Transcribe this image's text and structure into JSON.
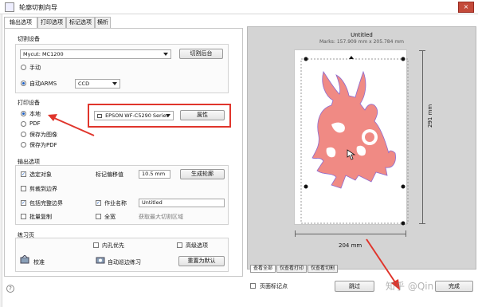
{
  "window": {
    "title": "轮廓切割向导",
    "close_glyph": "×"
  },
  "tabs": [
    {
      "label": "输出选项",
      "active": true
    },
    {
      "label": "打印选项",
      "active": false
    },
    {
      "label": "标记选项",
      "active": false
    },
    {
      "label": "横析",
      "active": false
    }
  ],
  "cut_device": {
    "section_label": "切割设备",
    "device_select_value": "Mycut: MC1200",
    "cut_backend_button": "切割后台",
    "manual_label": "手动",
    "auto_arms_label": "自动ARMS",
    "camera_select_value": "CCD",
    "manual_selected": false,
    "auto_selected": true
  },
  "print_device": {
    "section_label": "打印设备",
    "options": [
      {
        "label": "本地",
        "selected": true
      },
      {
        "label": "PDF",
        "selected": false
      },
      {
        "label": "保存为图像",
        "selected": false
      },
      {
        "label": "保存为PDF",
        "selected": false
      }
    ],
    "printer_select_value": "EPSON WF-C5290 Series",
    "properties_button": "属性"
  },
  "output_options": {
    "section_label": "输出选项",
    "select_object_label": "选定对象",
    "select_object_checked": true,
    "clip_to_border_label": "剪裁到边界",
    "clip_to_border_checked": false,
    "include_full_border_label": "包括完整边界",
    "include_full_border_checked": true,
    "batch_copy_label": "批量复制",
    "batch_copy_checked": false,
    "mark_offset_label": "标记偏移值",
    "mark_offset_value": "10.5 mm",
    "generate_contour_button": "生成轮廓",
    "job_name_label": "作业名称",
    "job_name_checked": true,
    "job_name_value": "Untitled",
    "full_width_label": "全宽",
    "full_width_checked": false,
    "full_width_hint": "获取最大切割区域"
  },
  "practice": {
    "section_label": "练习页",
    "inner_hole_label": "内孔优先",
    "inner_hole_checked": false,
    "advanced_label": "高级选项",
    "advanced_checked": false,
    "calibrate_label": "校准",
    "auto_patrol_label": "自动巡边练习",
    "reset_default_button": "重置为默认"
  },
  "preview": {
    "title": "Untitled",
    "marks": "Marks: 157.909 mm x 205.784 mm",
    "width_dim": "204 mm",
    "height_dim": "291 mm",
    "bottom_tabs": [
      "查看全部",
      "仅查看打印",
      "仅查看切割"
    ],
    "artwork_color": "#f08a84"
  },
  "footer": {
    "help_glyph": "?",
    "page_marks_label": "页面标记点",
    "page_marks_checked": false,
    "skip_button": "跳过",
    "finish_button": "完成",
    "watermark": "知乎 @Qin"
  },
  "annotation_color": "#e0352c"
}
